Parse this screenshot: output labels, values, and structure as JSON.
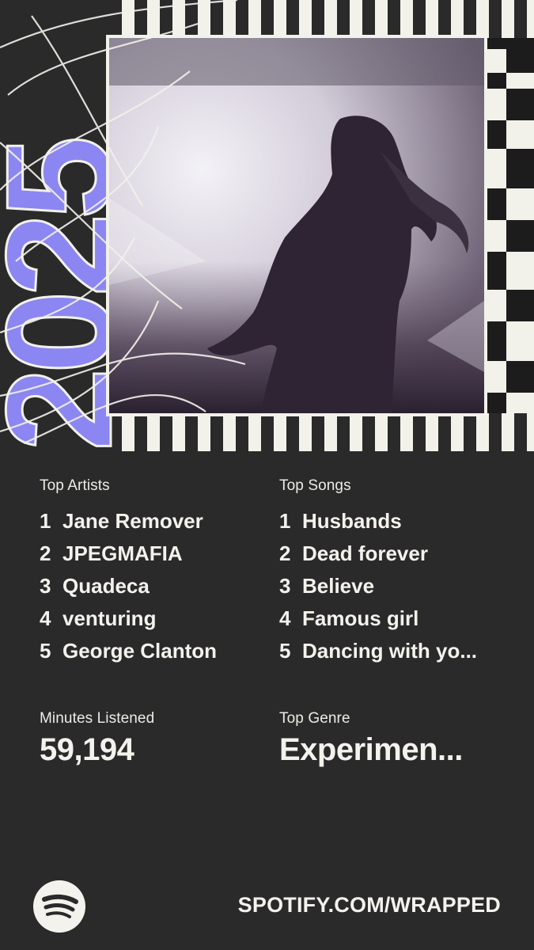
{
  "header": {
    "year_text": "2025",
    "colors": {
      "year_accent": "#8c86f2",
      "stripe_light": "#f2f1ea",
      "stripe_dark": "#1c1c1c",
      "background": "#2a2a2a"
    },
    "cover_image": "person-silhouette-concert-photo"
  },
  "top_artists": {
    "label": "Top Artists",
    "items": [
      {
        "rank": "1",
        "name": "Jane Remover"
      },
      {
        "rank": "2",
        "name": "JPEGMAFIA"
      },
      {
        "rank": "3",
        "name": "Quadeca"
      },
      {
        "rank": "4",
        "name": "venturing"
      },
      {
        "rank": "5",
        "name": "George Clanton"
      }
    ]
  },
  "top_songs": {
    "label": "Top Songs",
    "items": [
      {
        "rank": "1",
        "name": "Husbands"
      },
      {
        "rank": "2",
        "name": "Dead forever"
      },
      {
        "rank": "3",
        "name": "Believe"
      },
      {
        "rank": "4",
        "name": "Famous girl"
      },
      {
        "rank": "5",
        "name": "Dancing with yo..."
      }
    ]
  },
  "minutes": {
    "label": "Minutes Listened",
    "value": "59,194"
  },
  "genre": {
    "label": "Top Genre",
    "value": "Experimen..."
  },
  "footer": {
    "logo_icon": "spotify-logo-icon",
    "url": "SPOTIFY.COM/WRAPPED"
  }
}
